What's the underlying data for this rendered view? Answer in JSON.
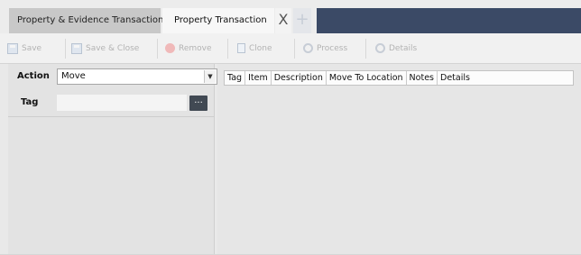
{
  "tabs": [
    {
      "label": "Property & Evidence Transaction",
      "active": false
    },
    {
      "label": "Property Transaction",
      "active": true
    }
  ],
  "tab_controls": {
    "close_glyph": "X",
    "add_glyph": "+"
  },
  "toolbar": {
    "save_label": "Save",
    "save_close_label": "Save & Close",
    "remove_label": "Remove",
    "clone_label": "Clone",
    "process_label": "Process",
    "details_label": "Details",
    "icons": {
      "save": "save-disk-icon",
      "save_close": "save-disk-icon",
      "remove": "remove-icon",
      "clone": "clone-icon",
      "process": "process-gear-icon",
      "details": "details-gear-icon"
    }
  },
  "form": {
    "action_label": "Action",
    "action_value": "Move",
    "tag_label": "Tag",
    "tag_value": "",
    "tag_button_label": "..."
  },
  "grid": {
    "columns": [
      "Tag",
      "Item",
      "Description",
      "Move To Location",
      "Notes",
      "Details"
    ],
    "rows": []
  },
  "colors": {
    "tab_bar_accent": "#3b4a66",
    "tag_button": "#414953"
  }
}
